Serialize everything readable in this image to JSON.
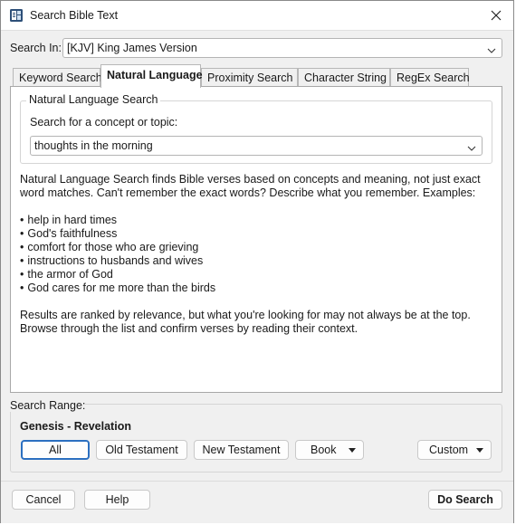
{
  "window": {
    "title": "Search Bible Text"
  },
  "search_in": {
    "label": "Search In:",
    "value": "[KJV] King James Version"
  },
  "tabs": [
    {
      "label": "Keyword Search",
      "active": false
    },
    {
      "label": "Natural Language",
      "active": true
    },
    {
      "label": "Proximity Search",
      "active": false
    },
    {
      "label": "Character String",
      "active": false
    },
    {
      "label": "RegEx Search",
      "active": false
    }
  ],
  "nl": {
    "group_title": "Natural Language Search",
    "prompt_label": "Search for a concept or topic:",
    "query_value": "thoughts in the morning",
    "description": "Natural Language Search finds Bible verses based on concepts and meaning, not just exact word matches. Can't remember the exact words? Describe what you remember. Examples:",
    "examples": [
      "help in hard times",
      "God's faithfulness",
      "comfort for those who are grieving",
      "instructions to husbands and wives",
      "the armor of God",
      "God cares for me more than the birds"
    ],
    "note": "Results are ranked by relevance, but what you're looking for may not always be at the top. Browse through the list and confirm verses by reading their context."
  },
  "range": {
    "title": "Search Range:",
    "current": "Genesis - Revelation",
    "all_label": "All",
    "ot_label": "Old Testament",
    "nt_label": "New Testament",
    "book_label": "Book",
    "custom_label": "Custom"
  },
  "footer": {
    "cancel_label": "Cancel",
    "help_label": "Help",
    "search_label": "Do Search"
  },
  "colors": {
    "focus": "#2b6fc0",
    "panel_bg": "#ffffff",
    "window_bg": "#f0f0f0"
  }
}
